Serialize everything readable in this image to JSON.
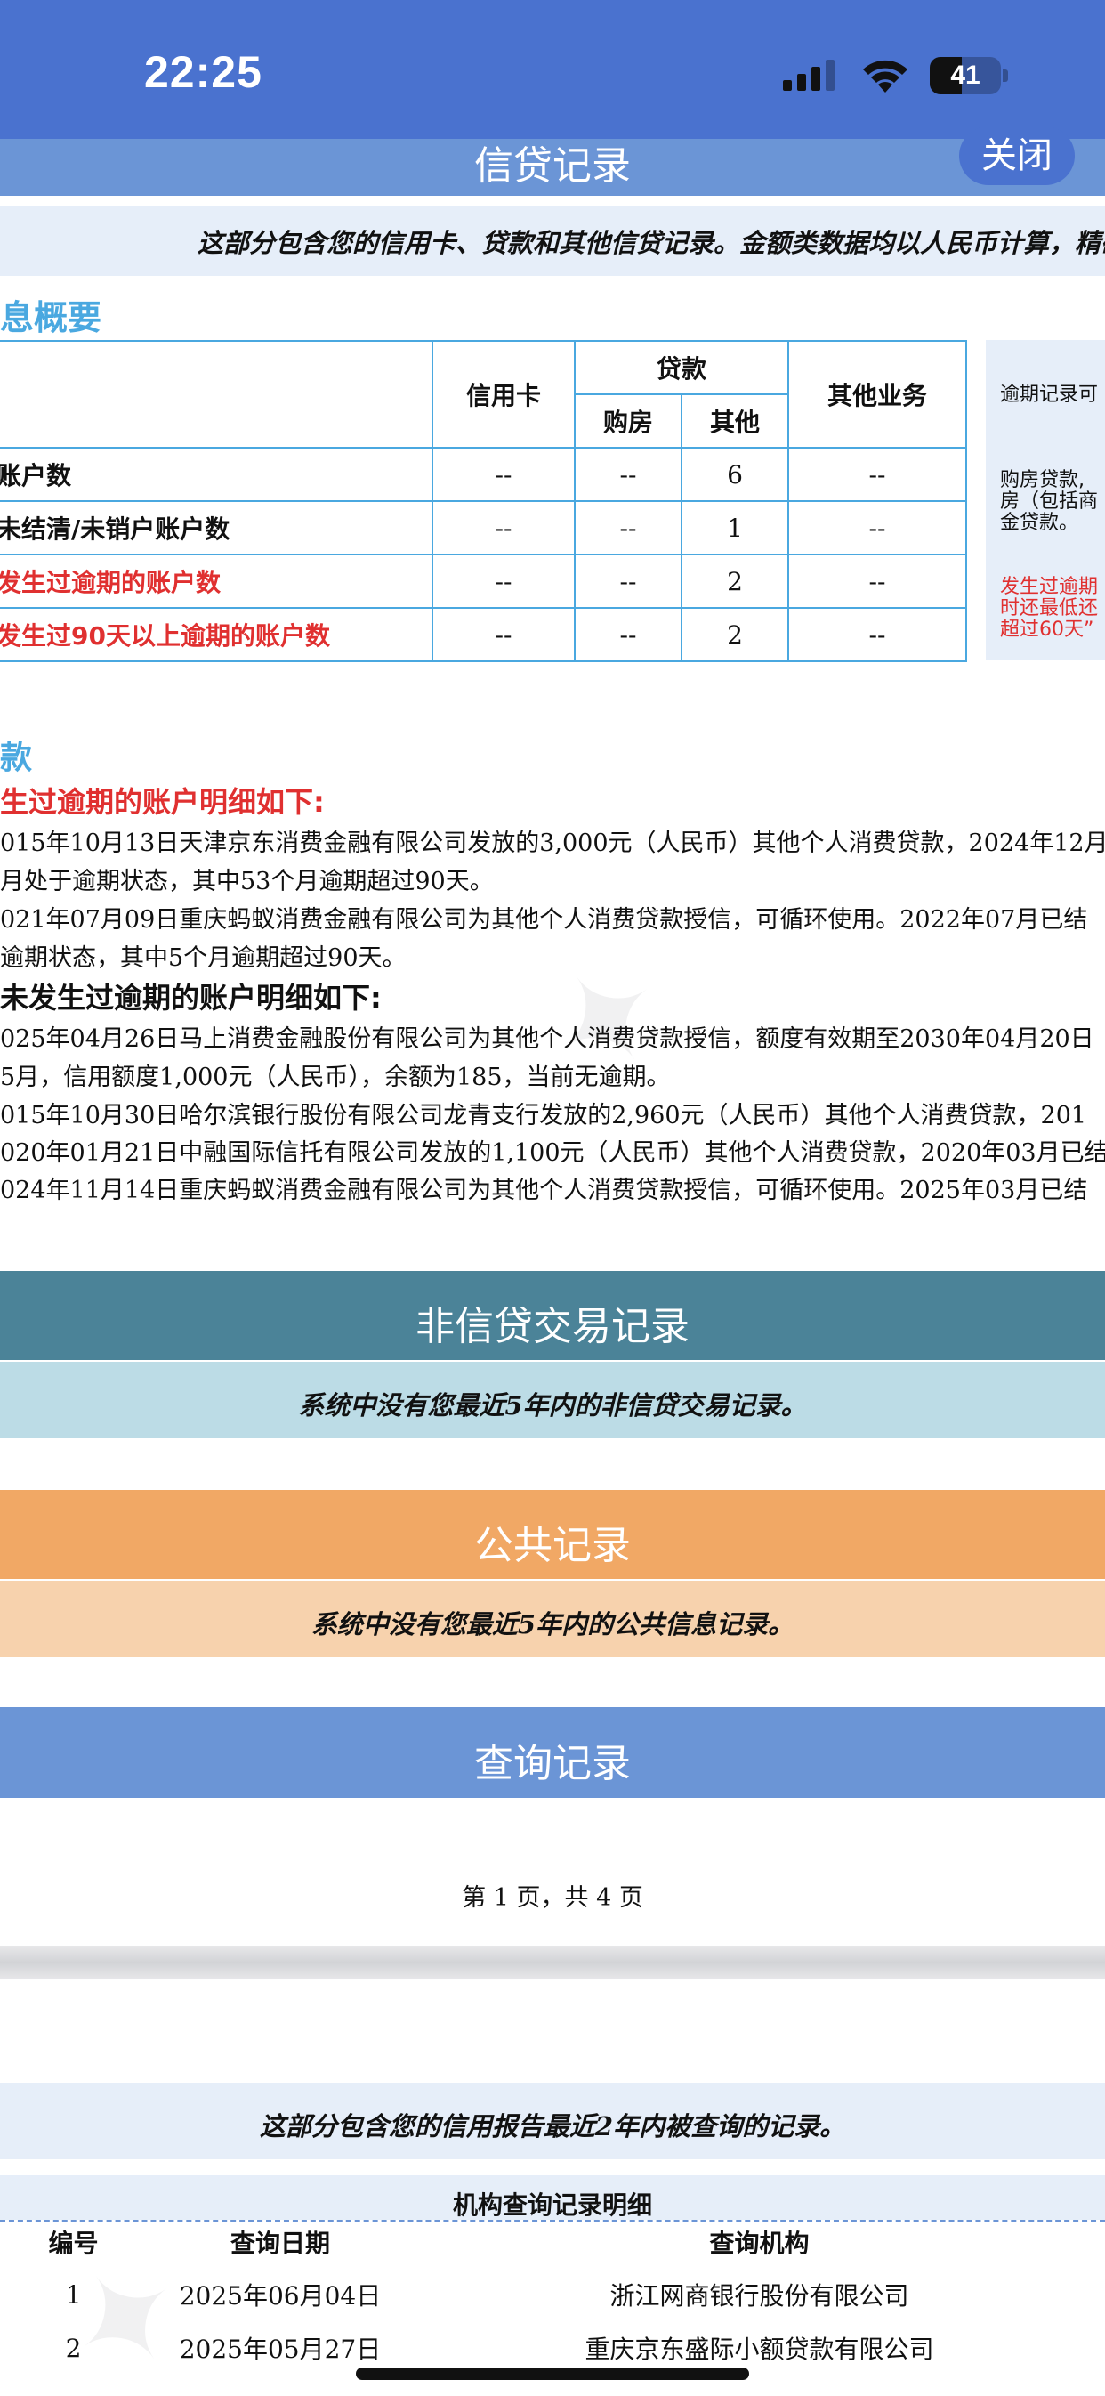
{
  "status_bar": {
    "time": "22:25",
    "battery": "41"
  },
  "header": {
    "title": "信贷记录",
    "close_label": "关闭"
  },
  "intro": "这部分包含您的信用卡、贷款和其他信贷记录。金额类数据均以人民币计算，精确",
  "summary": {
    "title": "息概要",
    "col_credit_card": "信用卡",
    "col_loan": "贷款",
    "col_loan_house": "购房",
    "col_loan_other": "其他",
    "col_other_business": "其他业务",
    "rows": [
      {
        "label": "账户数",
        "cells": [
          "--",
          "--",
          "6",
          "--"
        ],
        "red": false
      },
      {
        "label": "未结清/未销户账户数",
        "cells": [
          "--",
          "--",
          "1",
          "--"
        ],
        "red": false
      },
      {
        "label": "发生过逾期的账户数",
        "cells": [
          "--",
          "--",
          "2",
          "--"
        ],
        "red": true
      },
      {
        "label": "发生过90天以上逾期的账户数",
        "cells": [
          "--",
          "--",
          "2",
          "--"
        ],
        "red": true
      }
    ],
    "side_note_1": "逾期记录可",
    "side_note_2": [
      "购房贷款,",
      "房（包括商",
      "金贷款。"
    ],
    "side_note_3": [
      "发生过逾期",
      "时还最低还",
      "超过60天”"
    ]
  },
  "loans": {
    "heading": "款",
    "overdue_title": "生过逾期的账户明细如下:",
    "overdue_items": [
      "015年10月13日天津京东消费金融有限公司发放的3,000元（人民币）其他个人消费贷款，2024年12月",
      "月处于逾期状态，其中53个月逾期超过90天。",
      "021年07月09日重庆蚂蚁消费金融有限公司为其他个人消费贷款授信，可循环使用。2022年07月已结",
      "逾期状态，其中5个月逾期超过90天。"
    ],
    "normal_title": "未发生过逾期的账户明细如下:",
    "normal_items": [
      "025年04月26日马上消费金融股份有限公司为其他个人消费贷款授信，额度有效期至2030年04月20日",
      "5月，信用额度1,000元（人民币），余额为185，当前无逾期。",
      "015年10月30日哈尔滨银行股份有限公司龙青支行发放的2,960元（人民币）其他个人消费贷款，201",
      "020年01月21日中融国际信托有限公司发放的1,100元（人民币）其他个人消费贷款，2020年03月已结",
      "024年11月14日重庆蚂蚁消费金融有限公司为其他个人消费贷款授信，可循环使用。2025年03月已结"
    ]
  },
  "non_credit": {
    "title": "非信贷交易记录",
    "note": "系统中没有您最近5年内的非信贷交易记录。"
  },
  "public": {
    "title": "公共记录",
    "note": "系统中没有您最近5年内的公共信息记录。"
  },
  "query": {
    "title": "查询记录",
    "page_indicator": "第 1 页，共 4 页",
    "intro": "这部分包含您的信用报告最近2年内被查询的记录。",
    "detail_title": "机构查询记录明细",
    "columns": [
      "编号",
      "查询日期",
      "查询机构"
    ],
    "rows": [
      [
        "1",
        "2025年06月04日",
        "浙江网商银行股份有限公司"
      ],
      [
        "2",
        "2025年05月27日",
        "重庆京东盛际小额贷款有限公司"
      ]
    ]
  },
  "colors": {
    "status_blue": "#4a72cf",
    "header_blue": "#6b95d6",
    "non_credit_teal": "#4b8398",
    "public_orange": "#f1a865",
    "query_blue": "#6b95d6"
  }
}
